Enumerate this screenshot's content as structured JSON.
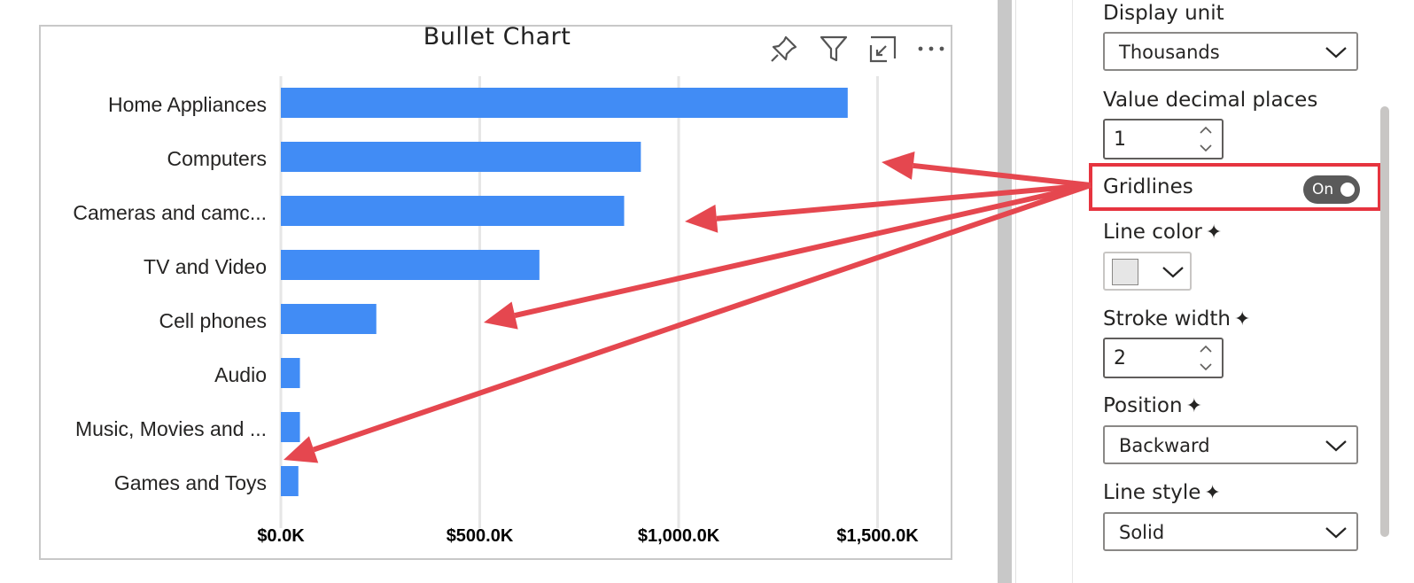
{
  "visual": {
    "title": "Bullet Chart",
    "icons": [
      "pin-icon",
      "filter-icon",
      "focus-mode-icon",
      "more-options-icon"
    ]
  },
  "chart_data": {
    "type": "bar",
    "orientation": "horizontal",
    "title": "Bullet Chart",
    "categories": [
      "Home Appliances",
      "Computers",
      "Cameras and camc...",
      "TV and Video",
      "Cell phones",
      "Audio",
      "Music, Movies and ...",
      "Games and Toys"
    ],
    "values": [
      1425,
      905,
      863,
      650,
      240,
      48,
      48,
      44
    ],
    "xlim": [
      0,
      1600
    ],
    "x_ticks": [
      0,
      500,
      1000,
      1500
    ],
    "x_tick_labels": [
      "$0.0K",
      "$500.0K",
      "$1,000.0K",
      "$1,500.0K"
    ],
    "unit": "K",
    "grid": true,
    "bar_color": "#418CF5",
    "gridline_color": "#e6e6e6"
  },
  "format_pane": {
    "display_unit_label": "Display unit",
    "display_unit_value": "Thousands",
    "decimal_label": "Value decimal places",
    "decimal_value": "1",
    "gridlines_label": "Gridlines",
    "gridlines_toggle": "On",
    "line_color_label": "Line color",
    "line_color_value": "#e6e6e6",
    "stroke_width_label": "Stroke width",
    "stroke_width_value": "2",
    "position_label": "Position",
    "position_value": "Backward",
    "line_style_label": "Line style",
    "line_style_value": "Solid",
    "sparkle": "✦"
  },
  "annotation": {
    "highlight_color": "#e6343f",
    "arrow_color": "#e5474f"
  }
}
